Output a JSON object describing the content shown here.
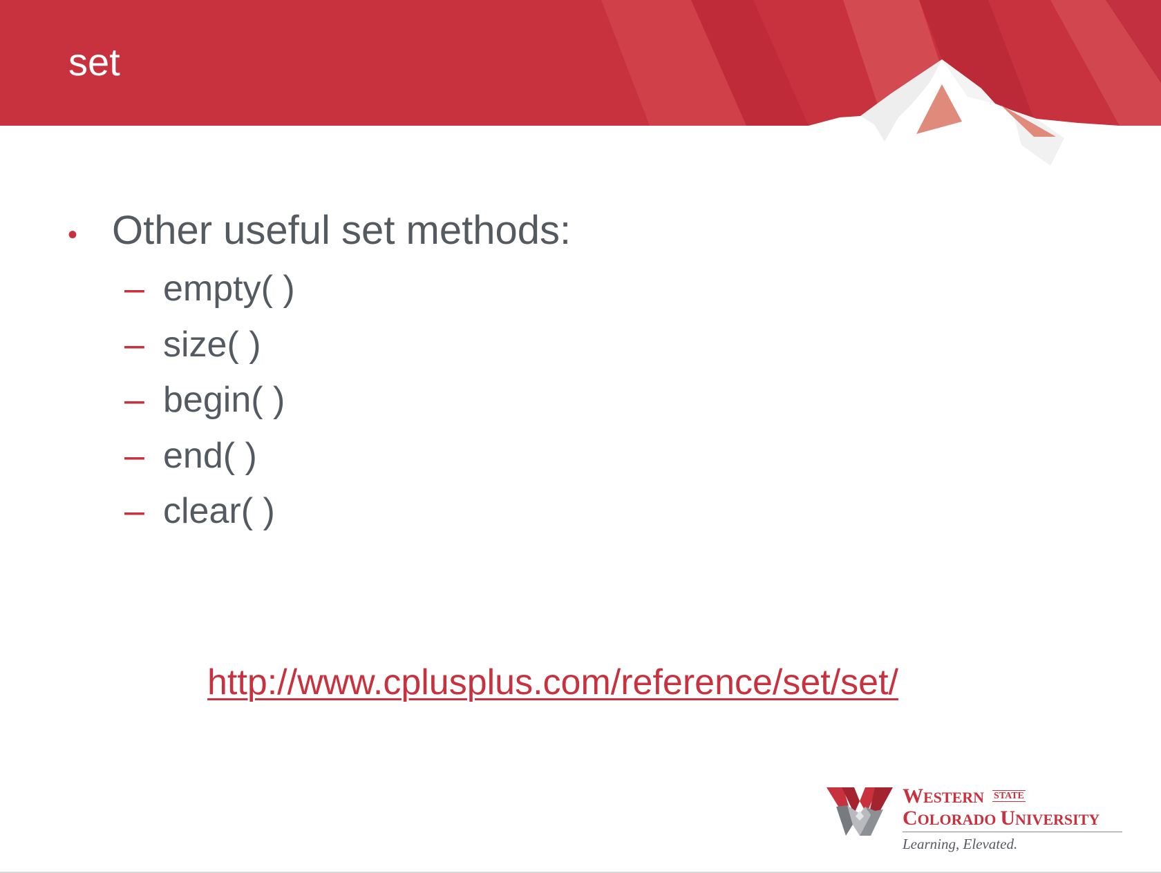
{
  "slide": {
    "title": "set",
    "bullet": "Other useful set methods:",
    "methods": [
      "empty( )",
      "size( )",
      "begin( )",
      "end( )",
      "clear( )"
    ],
    "link": "http://www.cplusplus.com/reference/set/set/"
  },
  "logo": {
    "western": "WESTERN",
    "state": "STATE",
    "colorado_university": "COLORADO UNIVERSITY",
    "tagline": "Learning, Elevated."
  },
  "colors": {
    "brand_red": "#c8323f",
    "text_gray": "#555a60"
  },
  "icons": {
    "bullet": "bullet-dot-icon",
    "sub_bullet": "dash-icon",
    "logo_mark": "western-w-mountain-icon"
  }
}
